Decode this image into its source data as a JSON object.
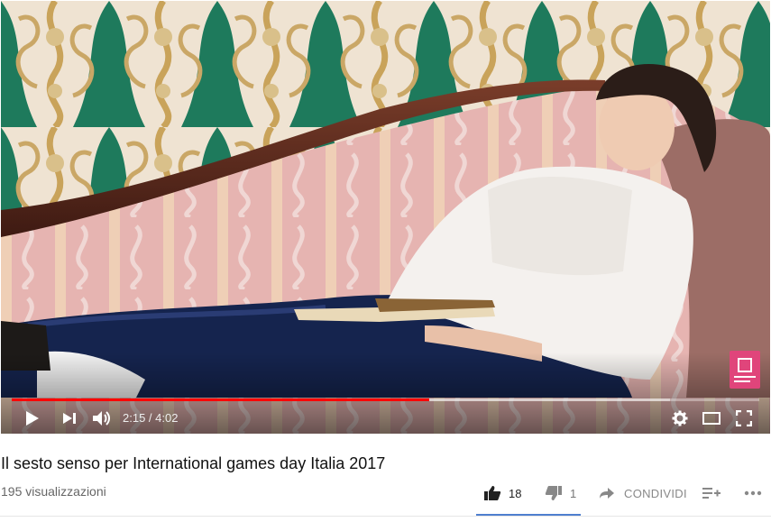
{
  "player": {
    "current_time": "2:15",
    "duration": "4:02",
    "time_separator": " / ",
    "progress_fraction": 0.559,
    "buffered_fraction": 0.88,
    "colors": {
      "progress": "#ff0000",
      "track": "#ffffff"
    },
    "controls": {
      "play_icon": "play-icon",
      "next_icon": "next-icon",
      "volume_icon": "volume-icon",
      "settings_icon": "gear-icon",
      "theater_icon": "theater-mode-icon",
      "fullscreen_icon": "fullscreen-icon"
    }
  },
  "video": {
    "title": "Il sesto senso per International games day Italia 2017",
    "views": "195 visualizzazioni"
  },
  "actions": {
    "like_count": "18",
    "dislike_count": "1",
    "share_label": "CONDIVIDI",
    "add_icon": "add-to-playlist-icon",
    "more_icon": "more-icon"
  }
}
